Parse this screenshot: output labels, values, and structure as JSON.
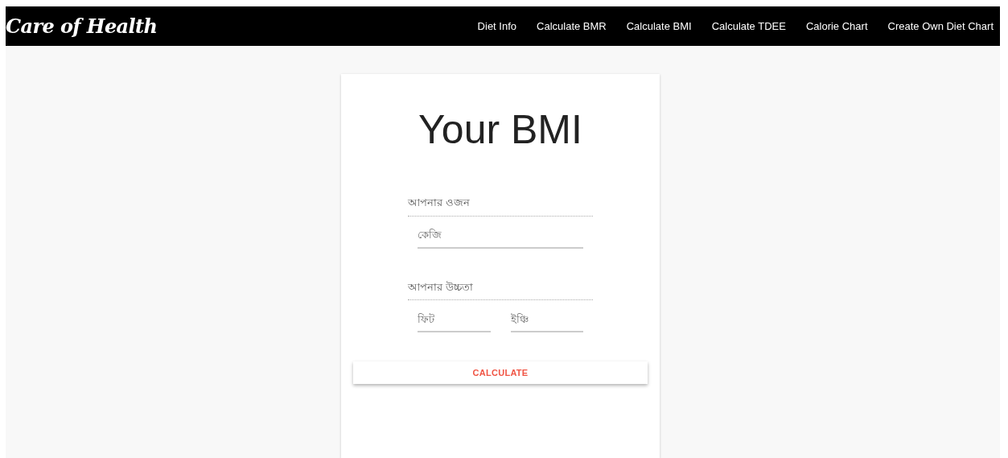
{
  "navbar": {
    "brand": "Care of Health",
    "links": [
      "Diet Info",
      "Calculate BMR",
      "Calculate BMI",
      "Calculate TDEE",
      "Calorie Chart",
      "Create Own Diet Chart"
    ]
  },
  "card": {
    "title": "Your BMI",
    "sections": [
      {
        "label": "আপনার ওজন",
        "fields": [
          {
            "placeholder": "কেজি"
          }
        ]
      },
      {
        "label": "আপনার উচ্চতা",
        "fields": [
          {
            "placeholder": "ফিট"
          },
          {
            "placeholder": "ইঞ্চি"
          }
        ]
      }
    ],
    "button": "CALCULATE"
  }
}
